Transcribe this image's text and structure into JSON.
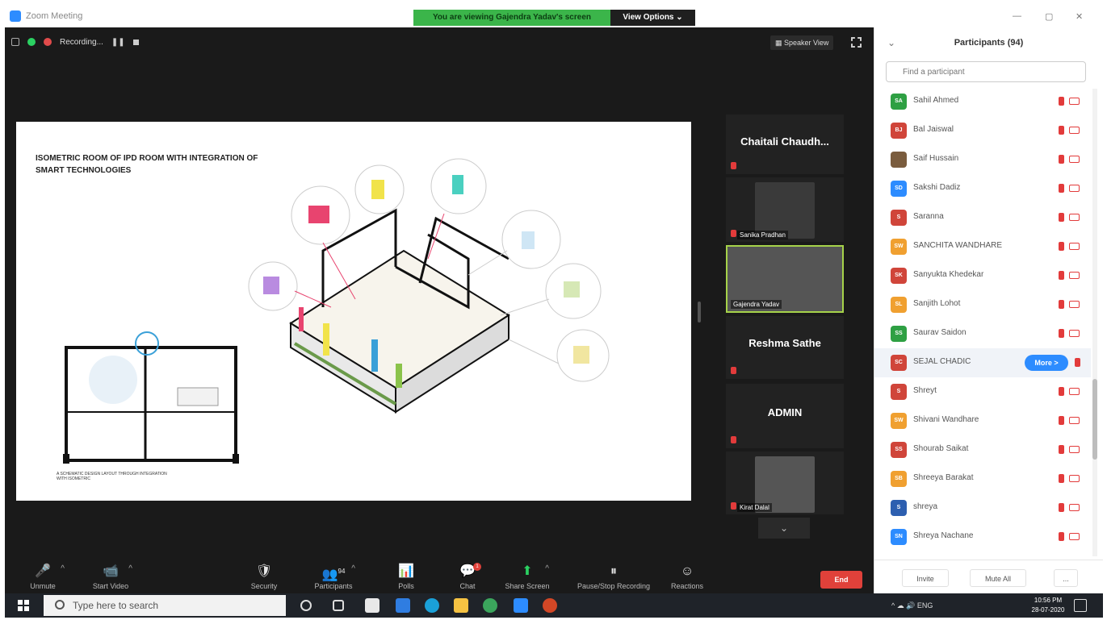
{
  "window": {
    "title": "Zoom Meeting",
    "share_banner": "You are viewing Gajendra Yadav's screen",
    "view_options": "View Options ⌄",
    "minimize": "—",
    "maximize": "▢",
    "close": "✕"
  },
  "top_bar": {
    "recording_label": "Recording...",
    "speaker_view": "Speaker View"
  },
  "slide": {
    "title": "ISOMETRIC ROOM OF IPD ROOM WITH INTEGRATION OF SMART TECHNOLOGIES",
    "caption": "A SCHEMATIC DESIGN LAYOUT THROUGH INTEGRATION WITH ISOMETRIC"
  },
  "tiles": [
    {
      "name": "Chaitali Chaudh...",
      "type": "name"
    },
    {
      "name": "Sanika Pradhan",
      "type": "photo",
      "photo_color": "#3a3a3a"
    },
    {
      "name": "Gajendra Yadav",
      "type": "photo-active",
      "photo_color": "#6b6b6b"
    },
    {
      "name": "Reshma Sathe",
      "type": "name"
    },
    {
      "name": "ADMIN",
      "type": "name"
    },
    {
      "name": "Kirat Dalal",
      "type": "photo",
      "photo_color": "#555555"
    }
  ],
  "controls": [
    {
      "label": "Unmute",
      "icon": "🎤"
    },
    {
      "label": "Start Video",
      "icon": "📹"
    },
    {
      "label": "Security",
      "icon": "🛡"
    },
    {
      "label": "Participants",
      "icon": "👥",
      "count": "94"
    },
    {
      "label": "Polls",
      "icon": "📊"
    },
    {
      "label": "Chat",
      "icon": "💬",
      "badge": "1"
    },
    {
      "label": "Share Screen",
      "icon": "⬆"
    },
    {
      "label": "Pause/Stop Recording",
      "icon": "⏸"
    },
    {
      "label": "Reactions",
      "icon": "☺"
    }
  ],
  "end_button": "End",
  "panel": {
    "title": "Participants (94)",
    "search_placeholder": "Find a participant",
    "more_button": "More >",
    "participants": [
      {
        "initials": "SA",
        "name": "Sahil Ahmed",
        "color": "#2ea043"
      },
      {
        "initials": "BJ",
        "name": "Bal Jaiswal",
        "color": "#d0453a"
      },
      {
        "initials": "",
        "name": "Saif Hussain",
        "color": "#7a5c3e"
      },
      {
        "initials": "SD",
        "name": "Sakshi Dadiz",
        "color": "#2d8cff"
      },
      {
        "initials": "S",
        "name": "Saranna",
        "color": "#d0453a"
      },
      {
        "initials": "SW",
        "name": "SANCHITA WANDHARE",
        "color": "#f0a030"
      },
      {
        "initials": "SK",
        "name": "Sanyukta Khedekar",
        "color": "#d0453a"
      },
      {
        "initials": "SL",
        "name": "Sanjith Lohot",
        "color": "#f0a030"
      },
      {
        "initials": "SS",
        "name": "Saurav Saidon",
        "color": "#2ea043"
      },
      {
        "initials": "SC",
        "name": "SEJAL CHADIC",
        "color": "#d0453a",
        "highlighted": true
      },
      {
        "initials": "S",
        "name": "Shreyt",
        "color": "#d0453a"
      },
      {
        "initials": "SW",
        "name": "Shivani Wandhare",
        "color": "#f0a030"
      },
      {
        "initials": "SS",
        "name": "Shourab Saikat",
        "color": "#d0453a"
      },
      {
        "initials": "SB",
        "name": "Shreeya Barakat",
        "color": "#f0a030"
      },
      {
        "initials": "S",
        "name": "shreya",
        "color": "#2d5fb0"
      },
      {
        "initials": "SN",
        "name": "Shreya Nachane",
        "color": "#2d8cff"
      },
      {
        "initials": "",
        "name": "",
        "color": "#2ea043"
      }
    ],
    "footer": {
      "invite": "Invite",
      "mute_all": "Mute All",
      "more": "..."
    }
  },
  "taskbar": {
    "search_placeholder": "Type here to search",
    "tray_text": "^ ☁ 🔊 ENG",
    "time": "10:56 PM",
    "date": "28-07-2020"
  }
}
